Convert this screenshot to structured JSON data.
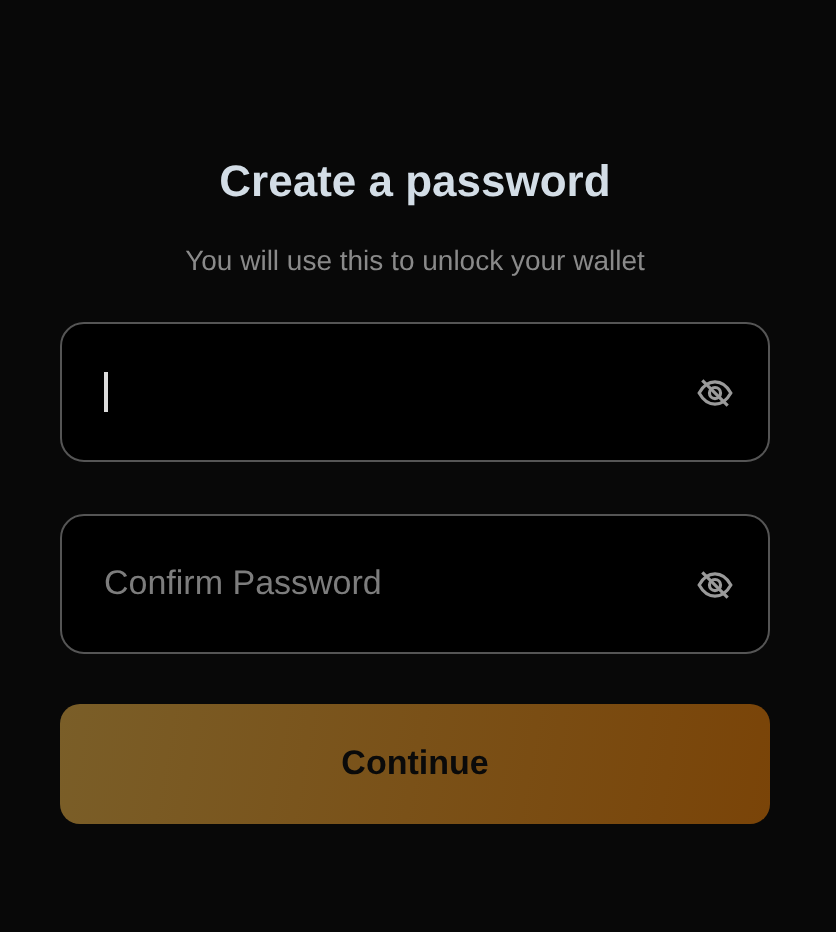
{
  "title": "Create a password",
  "subtitle": "You will use this to unlock your wallet",
  "fields": [
    {
      "focused": true
    },
    {
      "placeholder": "Confirm Password",
      "focused": false
    }
  ],
  "button": "Continue"
}
